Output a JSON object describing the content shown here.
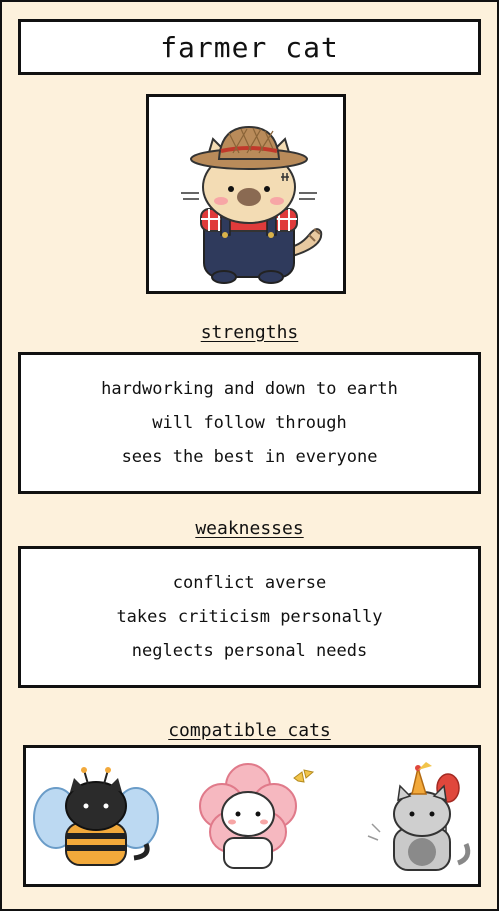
{
  "title": "farmer cat",
  "strengths": {
    "heading": "strengths",
    "items": [
      "hardworking and down to earth",
      "will follow through",
      "sees the best in everyone"
    ]
  },
  "weaknesses": {
    "heading": "weaknesses",
    "items": [
      "conflict averse",
      "takes criticism personally",
      "neglects personal needs"
    ]
  },
  "compatible": {
    "heading": "compatible cats",
    "cats": [
      "bee-cat-icon",
      "flower-cat-icon",
      "party-cat-icon"
    ]
  },
  "colors": {
    "background": "#fdf1dc",
    "border": "#111111",
    "overalls": "#2f3a5c",
    "hat": "#b98b5a",
    "shirt": "#e03b3b"
  }
}
